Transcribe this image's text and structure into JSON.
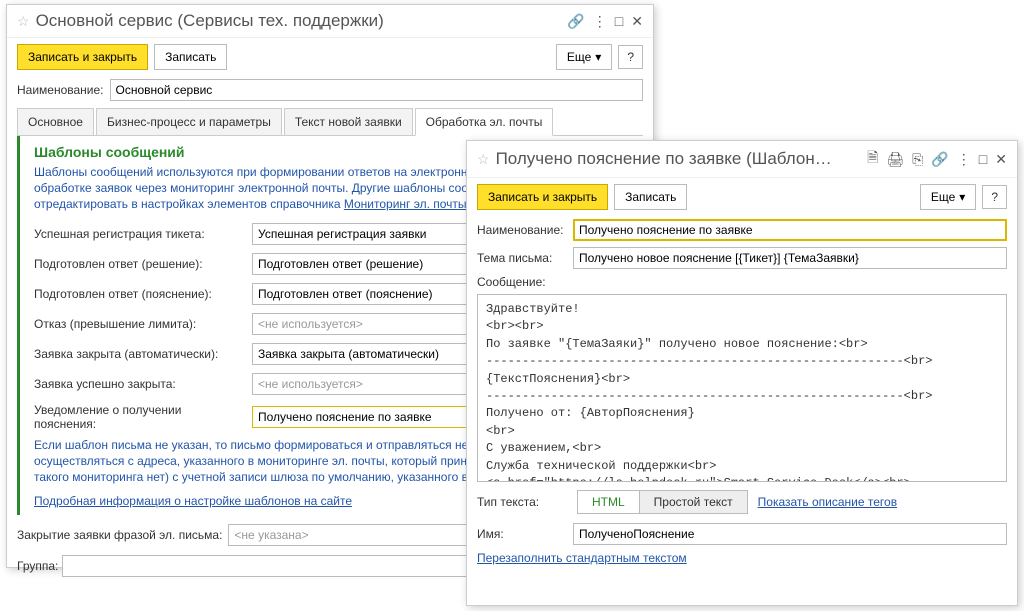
{
  "win1": {
    "title": "Основной сервис (Сервисы тех. поддержки)",
    "save_close": "Записать и закрыть",
    "save": "Записать",
    "more": "Еще",
    "name_label": "Наименование:",
    "name_value": "Основной сервис",
    "tabs": [
      "Основное",
      "Бизнес-процесс и параметры",
      "Текст новой заявки",
      "Обработка эл. почты"
    ],
    "section": "Шаблоны сообщений",
    "desc1": "Шаблоны сообщений используются при формировании ответов на электронную",
    "desc2": "обработке заявок через мониторинг электронной почты. Другие шаблоны сообщ",
    "desc3": "отредактировать в настройках элементов справочника ",
    "desc3_link": "Мониторинг эл. почты",
    "rows": {
      "r1_label": "Успешная регистрация тикета:",
      "r1_value": "Успешная регистрация заявки",
      "r2_label": "Подготовлен ответ (решение):",
      "r2_value": "Подготовлен ответ (решение)",
      "r3_label": "Подготовлен ответ (пояснение):",
      "r3_value": "Подготовлен ответ (пояснение)",
      "r4_label": "Отказ (превышение лимита):",
      "r4_value": "<не используется>",
      "r5_label": "Заявка закрыта (автоматически):",
      "r5_value": "Заявка закрыта (автоматически)",
      "r6_label": "Заявка успешно закрыта:",
      "r6_value": "<не используется>",
      "r7_label": "Уведомление о получении пояснения:",
      "r7_value": "Получено пояснение по заявке"
    },
    "info1": "Если шаблон письма не указан, то письмо формироваться и отправляться не бу",
    "info2": "осуществляться с адреса, указанного в мониторинге эл. почты, который принял",
    "info3": "такого мониторинга нет) с учетной записи шлюза по умолчанию, указанного в н",
    "info_link": "Подробная информация о настройке шаблонов на сайте",
    "close_phrase_label": "Закрытие заявки фразой эл. письма:",
    "close_phrase_value": "<не указана>",
    "group_label": "Группа:"
  },
  "win2": {
    "title": "Получено пояснение по заявке (Шаблон…",
    "save_close": "Записать и закрыть",
    "save": "Записать",
    "more": "Еще",
    "name_label": "Наименование:",
    "name_value": "Получено пояснение по заявке",
    "subj_label": "Тема письма:",
    "subj_value": "Получено новое пояснение [{Тикет}] {ТемаЗаявки}",
    "msg_label": "Сообщение:",
    "msg_body": "Здравствуйте!\n<br><br>\nПо заявке \"{ТемаЗаяки}\" получено новое пояснение:<br>\n----------------------------------------------------------<br>\n{ТекстПояснения}<br>\n----------------------------------------------------------<br>\nПолучено от: {АвторПояснения}\n<br>\nС уважением,<br>\nСлужба технической поддержки<br>\n<a href=\"https://ls-helpdesk.ru\">Smart Service Desk</a><br>\nЭл. почта <a href=\"mailto:{ЭлПочтаШлюза}\">{ЭлПочтаШлюза}</a><br>",
    "type_label": "Тип текста:",
    "type_html": "HTML",
    "type_plain": "Простой текст",
    "tags_link": "Показать описание тегов",
    "id_label": "Имя:",
    "id_value": "ПолученоПояснение",
    "refill_link": "Перезаполнить стандартным текстом"
  }
}
